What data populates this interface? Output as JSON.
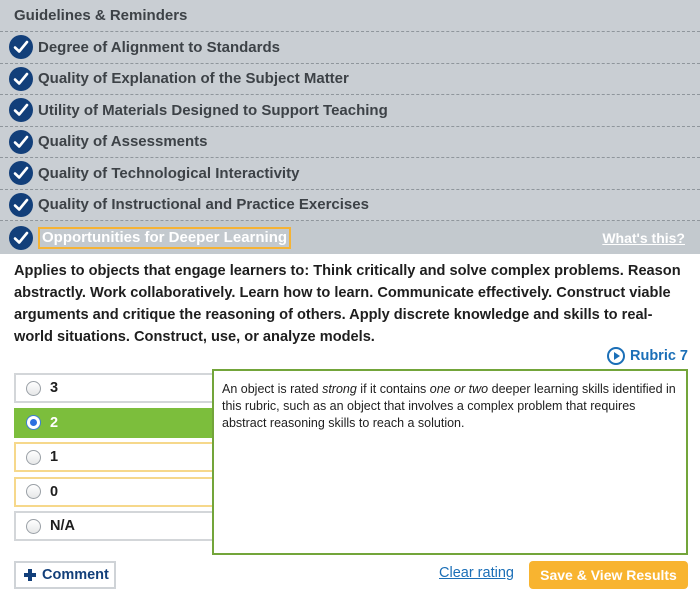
{
  "header": {
    "title": "Guidelines & Reminders"
  },
  "criteria": [
    {
      "label": "Degree of Alignment to Standards"
    },
    {
      "label": "Quality of Explanation of the Subject Matter"
    },
    {
      "label": "Utility of Materials Designed to Support Teaching"
    },
    {
      "label": "Quality of Assessments"
    },
    {
      "label": "Quality of Technological Interactivity"
    },
    {
      "label": "Quality of Instructional and Practice Exercises"
    }
  ],
  "active_criterion": {
    "label": "Opportunities for Deeper Learning",
    "help_link": "What's this?"
  },
  "description": "Applies to objects that engage learners to: Think critically and solve complex problems. Reason abstractly. Work collaboratively. Learn how to learn. Communicate effectively. Construct viable arguments and critique the reasoning of others. Apply discrete knowledge and skills to real-world situations. Construct, use, or analyze models.",
  "rubric": {
    "label": "Rubric 7",
    "icon": "play-circle-icon"
  },
  "ratings": [
    {
      "label": "3",
      "selected": false
    },
    {
      "label": "2",
      "selected": true
    },
    {
      "label": "1",
      "selected": false
    },
    {
      "label": "0",
      "selected": false
    },
    {
      "label": "N/A",
      "selected": false
    }
  ],
  "info": {
    "t1": "An object is rated ",
    "t2": "strong",
    "t3": " if it contains ",
    "t4": "one or two",
    "t5": " deeper learning skills identified in this rubric, such as an object that involves a complex problem that requires abstract reasoning skills to reach a solution."
  },
  "actions": {
    "comment": "Comment",
    "clear": "Clear rating",
    "save": "Save & View Results"
  },
  "colors": {
    "check": "#123f7a",
    "selected": "#7cbe3c",
    "save": "#f8b430",
    "link": "#1b6fb7"
  }
}
